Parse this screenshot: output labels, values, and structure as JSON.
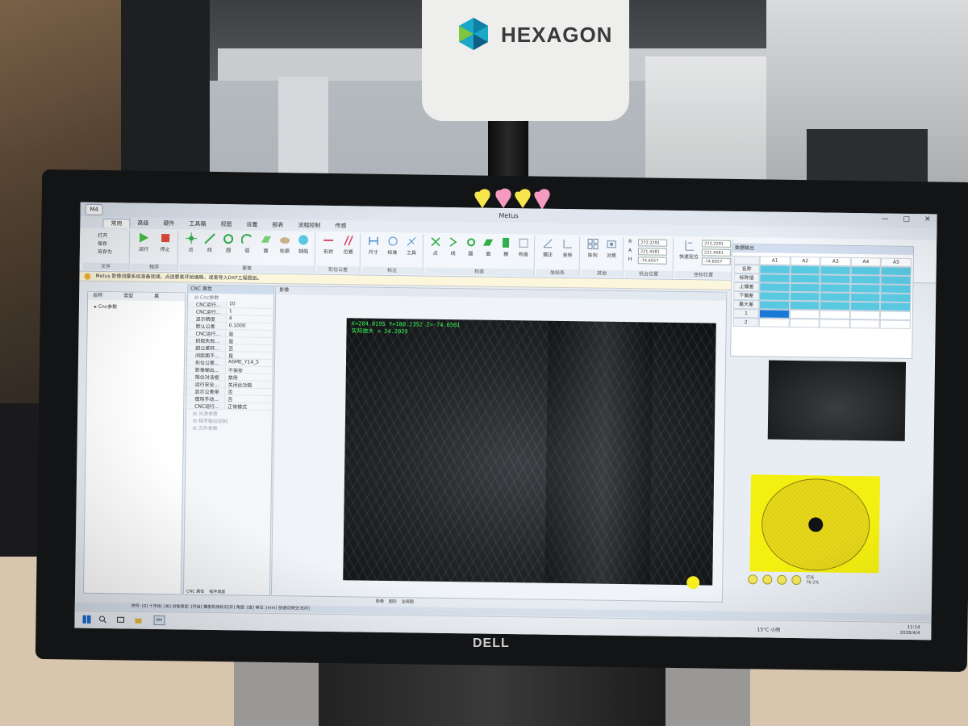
{
  "head": {
    "brand": "HEXAGON"
  },
  "monitor": {
    "brand": "DELL"
  },
  "app": {
    "title": "Metus",
    "icon_label": "M4",
    "window_controls": [
      "—",
      "□",
      "✕"
    ],
    "tabs": [
      "常用",
      "高级",
      "硬件",
      "工具箱",
      "视图",
      "设置",
      "报表",
      "流程控制",
      "传感"
    ],
    "ribbon": {
      "groups": [
        {
          "name": "文件",
          "buttons": [
            "打开",
            "保存",
            "另存为"
          ]
        },
        {
          "name": "程序",
          "buttons": [
            "运行",
            "停止"
          ]
        },
        {
          "name": "要素",
          "buttons": [
            "点",
            "线",
            "圆",
            "弧",
            "面",
            "轮廓",
            "缺陷"
          ]
        },
        {
          "name": "形位公差",
          "buttons": [
            "形状",
            "位置"
          ]
        },
        {
          "name": "标注",
          "buttons": [
            "尺寸",
            "标准",
            "工具"
          ]
        },
        {
          "name": "构造",
          "buttons": [
            "点",
            "线",
            "圆",
            "面",
            "栅",
            "构造"
          ]
        },
        {
          "name": "坐标系",
          "buttons": [
            "摆正",
            "坐标"
          ]
        },
        {
          "name": "其他",
          "buttons": [
            "阵列",
            "对焦"
          ]
        },
        {
          "name": "机台位置",
          "labels": [
            "R",
            "A",
            "H"
          ],
          "values": [
            "272.2291",
            "221.4581",
            "-74.6557"
          ]
        },
        {
          "name": "坐标位置",
          "button": "快速定位",
          "values": [
            "272.2291",
            "221.4581",
            "-74.6557"
          ]
        }
      ]
    },
    "message": "Metus 影像测量系统准备就绪。点选要素开始编程，或者导入DXF工程图纸。",
    "tree": {
      "headers": [
        "名称",
        "类型",
        "属"
      ],
      "rows": [
        "Cnc参数"
      ]
    },
    "properties": {
      "title": "CNC 属性",
      "section": "Cnc参数",
      "rows": [
        {
          "k": "CNC运行...",
          "v": "10"
        },
        {
          "k": "CNC运行...",
          "v": "1"
        },
        {
          "k": "显示精度",
          "v": "4"
        },
        {
          "k": "默认公差",
          "v": "0.1000"
        },
        {
          "k": "CNC运行...",
          "v": "是"
        },
        {
          "k": "抓取失败...",
          "v": "是"
        },
        {
          "k": "超公差转...",
          "v": "否"
        },
        {
          "k": "间距面不...",
          "v": "是"
        },
        {
          "k": "形位公差...",
          "v": "ASME_Y14_5"
        },
        {
          "k": "影像输出...",
          "v": "不保存"
        },
        {
          "k": "限位对话框",
          "v": "禁用"
        },
        {
          "k": "运行安全...",
          "v": "关闭此功能"
        },
        {
          "k": "显示公差带",
          "v": "否"
        },
        {
          "k": "使用手动...",
          "v": "否"
        },
        {
          "k": "CNC运行...",
          "v": "正常模式"
        }
      ],
      "groups": [
        "光源参数",
        "程序输出控制",
        "文件参数"
      ],
      "footer_tabs": [
        "CNC 属性",
        "程序调度"
      ]
    },
    "image_panel": {
      "tab": "影像",
      "coords": "X=204.0195  Y=180.2352  Z=-74.6561",
      "zoom": "实际放大 = 24.2029",
      "bottom_tabs": [
        "影像",
        "图形",
        "全局图"
      ]
    },
    "data_output": {
      "title": "数据输出",
      "columns": [
        "A1",
        "A2",
        "A3",
        "A4",
        "A5"
      ],
      "row_labels": [
        "名称",
        "标称值",
        "上偏差",
        "下偏差",
        "最大差",
        "1",
        "2"
      ]
    },
    "lighting_labels": [
      "打光",
      "76.2%"
    ],
    "statusbar": "称号: [0]     十字线: [关]     对象锁定: [开启]     模型检测标识[开]     角度: [度]     单位: [mm]     快速切换空[关闭]",
    "taskbar": {
      "app": "M4",
      "weather": "15°C 小雨",
      "time": "11:14",
      "date": "2026/4/4"
    }
  }
}
